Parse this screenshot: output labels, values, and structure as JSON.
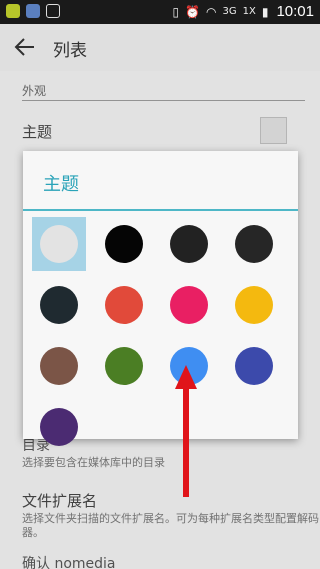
{
  "status_bar": {
    "network": "3G",
    "signal_label": "1X",
    "time": "10:01"
  },
  "app_bar": {
    "title": "列表"
  },
  "settings": {
    "section_header": "外观",
    "theme_label": "主题",
    "directories_label": "目录",
    "directories_summary": "选择要包含在媒体库中的目录",
    "extensions_label": "文件扩展名",
    "extensions_summary": "选择文件夹扫描的文件扩展名。可为每种扩展名类型配置解码器。",
    "nomedia_label": "确认 nomedia"
  },
  "dialog": {
    "title": "主题",
    "colors": [
      {
        "name": "light-gray",
        "hex": "#e3e3e3",
        "selected": true
      },
      {
        "name": "black",
        "hex": "#050505",
        "selected": false
      },
      {
        "name": "dark-gray",
        "hex": "#222222",
        "selected": false
      },
      {
        "name": "charcoal",
        "hex": "#262626",
        "selected": false
      },
      {
        "name": "blue-gray-dark",
        "hex": "#1f2a30",
        "selected": false
      },
      {
        "name": "red",
        "hex": "#e14a3a",
        "selected": false
      },
      {
        "name": "pink",
        "hex": "#e91f63",
        "selected": false
      },
      {
        "name": "amber",
        "hex": "#f4b90f",
        "selected": false
      },
      {
        "name": "brown",
        "hex": "#7b5547",
        "selected": false
      },
      {
        "name": "green",
        "hex": "#4b7e24",
        "selected": false
      },
      {
        "name": "blue",
        "hex": "#3f8ef2",
        "selected": false
      },
      {
        "name": "indigo",
        "hex": "#3c4aab",
        "selected": false
      },
      {
        "name": "deep-purple",
        "hex": "#4b2b72",
        "selected": false
      }
    ]
  },
  "colors": {
    "accent": "#2aa3b8",
    "arrow": "#e0141a"
  }
}
